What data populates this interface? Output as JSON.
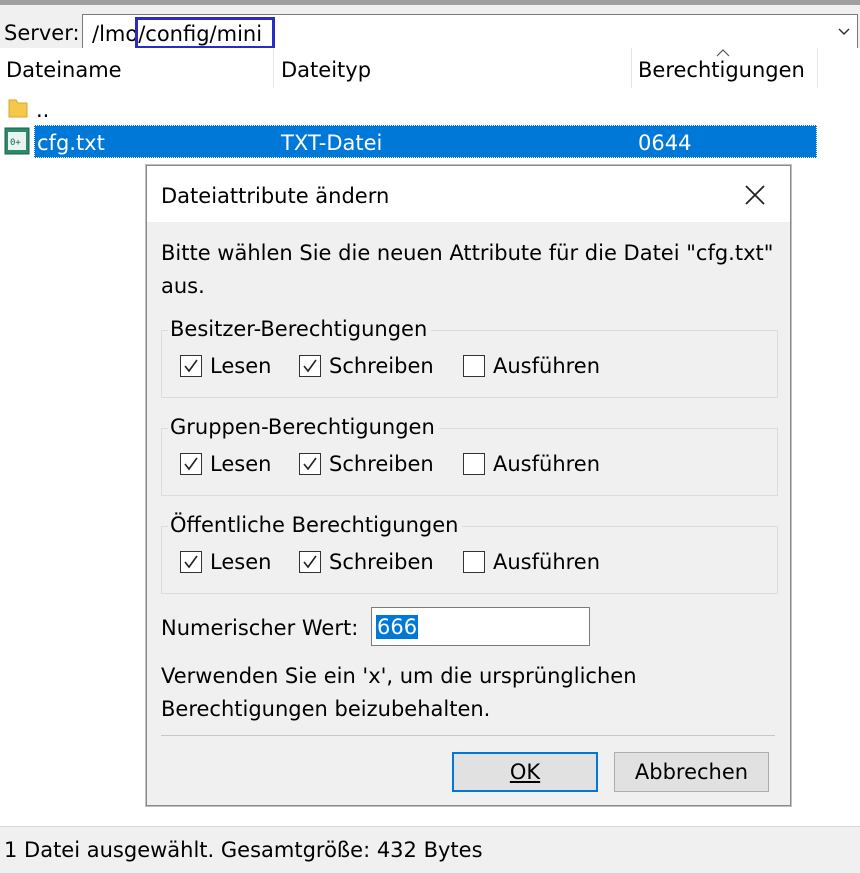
{
  "server_bar": {
    "label": "Server:",
    "path": "/lmo/config/mini"
  },
  "columns": {
    "name": "Dateiname",
    "type": "Dateityp",
    "permissions": "Berechtigungen"
  },
  "files": [
    {
      "name": "..",
      "type": "",
      "permissions": ""
    },
    {
      "name": "cfg.txt",
      "type": "TXT-Datei",
      "permissions": "0644"
    }
  ],
  "dialog": {
    "title": "Dateiattribute ändern",
    "description_line1": "Bitte wählen Sie die neuen Attribute für die Datei \"cfg.txt\"",
    "description_line2": "aus.",
    "groups": [
      {
        "title": "Besitzer-Berechtigungen",
        "read": "Lesen",
        "write": "Schreiben",
        "exec": "Ausführen",
        "read_checked": true,
        "write_checked": true,
        "exec_checked": false
      },
      {
        "title": "Gruppen-Berechtigungen",
        "read": "Lesen",
        "write": "Schreiben",
        "exec": "Ausführen",
        "read_checked": true,
        "write_checked": true,
        "exec_checked": false
      },
      {
        "title": "Öffentliche Berechtigungen",
        "read": "Lesen",
        "write": "Schreiben",
        "exec": "Ausführen",
        "read_checked": true,
        "write_checked": true,
        "exec_checked": false
      }
    ],
    "numeric_label": "Numerischer Wert:",
    "numeric_value": "666",
    "hint_line1": "Verwenden Sie ein 'x', um die ursprünglichen",
    "hint_line2": "Berechtigungen beizubehalten.",
    "ok_label": "OK",
    "cancel_label": "Abbrechen"
  },
  "status": {
    "text": "1 Datei ausgewählt. Gesamtgröße: 432 Bytes"
  },
  "colors": {
    "selection": "#0078d7",
    "highlight_box": "#2b2bc4",
    "folder": "#f5c84c"
  },
  "icons": [
    "folder-icon",
    "text-file-icon",
    "close-icon",
    "chevron-down-icon",
    "sort-up-icon",
    "checkmark-icon"
  ]
}
